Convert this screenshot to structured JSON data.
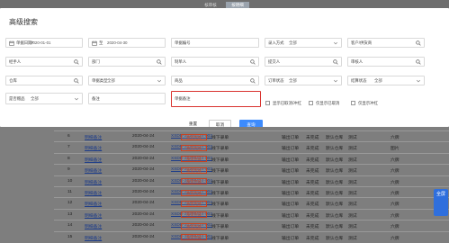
{
  "tabs": [
    "核审核",
    "按明细"
  ],
  "panel": {
    "title": "高级搜索"
  },
  "rows": [
    [
      {
        "label": "单据日期*",
        "value": "2020-01-01",
        "icon": "calendar-icon"
      },
      {
        "label": "至",
        "value": "2020-04-30",
        "icon": "calendar-icon"
      },
      {
        "label": "单据编号",
        "value": "",
        "icon": ""
      },
      {
        "label": "录入方式",
        "value": "全部",
        "icon": "chevron-down-icon"
      },
      {
        "label": "客户/供货商",
        "value": "",
        "icon": "search-icon"
      }
    ],
    [
      {
        "label": "经手人",
        "value": "",
        "icon": "search-icon"
      },
      {
        "label": "部门",
        "value": "",
        "icon": "search-icon"
      },
      {
        "label": "制单人",
        "value": "",
        "icon": "search-icon"
      },
      {
        "label": "提交人",
        "value": "",
        "icon": "search-icon"
      },
      {
        "label": "审核人",
        "value": "",
        "icon": "search-icon"
      }
    ],
    [
      {
        "label": "仓库",
        "value": "",
        "icon": "search-icon"
      },
      {
        "label": "单据类型",
        "value": "全部",
        "icon": "chevron-down-icon"
      },
      {
        "label": "商品",
        "value": "",
        "icon": "search-icon"
      },
      {
        "label": "订单状态",
        "value": "全部",
        "icon": "chevron-down-icon"
      },
      {
        "label": "结算状态",
        "value": "全部",
        "icon": "chevron-down-icon"
      }
    ],
    [
      {
        "label": "是否赠品",
        "value": "全部",
        "icon": "chevron-down-icon"
      },
      {
        "label": "备注",
        "value": "",
        "icon": ""
      },
      {
        "label": "单据备注",
        "value": "",
        "icon": ""
      }
    ]
  ],
  "checkboxes": [
    "显示已取消/冲红",
    "仅显示已取消",
    "仅显示冲红"
  ],
  "buttons": {
    "reset": "重置",
    "cancel": "取消",
    "query": "查询"
  },
  "table": [
    [
      "6",
      "明细备注",
      "2020-04-24",
      "XSDD-20200424-003",
      "线下录单",
      "按货完成",
      "输出订单",
      "未完成",
      "默认仓库",
      "测试",
      "六牌"
    ],
    [
      "7",
      "明细备注",
      "2020-04-24",
      "XSDD-20200424-003",
      "线下录单",
      "按货完成",
      "输出订单",
      "未完成",
      "默认仓库",
      "测试",
      "图片"
    ],
    [
      "8",
      "明细备注",
      "2020-04-24",
      "XSDD-20200424-003",
      "线下录单",
      "按货完成",
      "输出订单",
      "未完成",
      "默认仓库",
      "测试",
      "六牌"
    ],
    [
      "9",
      "明细备注",
      "2020-04-24",
      "XSDD-20200424-003",
      "线下录单",
      "按货完成",
      "输出订单",
      "未完成",
      "默认仓库",
      "测试",
      "六牌"
    ],
    [
      "10",
      "明细备注",
      "2020-04-24",
      "XSDD-20200424-004",
      "线下录单",
      "按货完成",
      "输出订单",
      "未完成",
      "默认仓库",
      "测试",
      "六牌"
    ],
    [
      "11",
      "明细备注",
      "2020-04-24",
      "XSDD-20200424-004",
      "线下录单",
      "按货完成",
      "输出订单",
      "未完成",
      "默认仓库",
      "测试",
      "六牌"
    ],
    [
      "12",
      "明细备注",
      "2020-04-24",
      "XSDD-20200424-004",
      "线下录单",
      "按货完成",
      "输出订单",
      "未完成",
      "默认仓库",
      "测试",
      "六牌"
    ],
    [
      "13",
      "明细备注",
      "2020-04-24",
      "XSDD-20200424-003",
      "线下录单",
      "按货完成",
      "输出订单",
      "未完成",
      "默认仓库",
      "测试",
      "六牌"
    ],
    [
      "14",
      "明细备注",
      "2020-04-24",
      "XSDD-20200424-002",
      "线下录单",
      "按货完成",
      "输出订单",
      "未完成",
      "默认仓库",
      "测试",
      "六牌"
    ],
    [
      "15",
      "明细备注",
      "2020-04-24",
      "XSDD-20200424-002",
      "线下录单",
      "按货完成",
      "输出订单",
      "未完成",
      "默认仓库",
      "测试",
      "六牌"
    ]
  ],
  "side_button": "全屏"
}
